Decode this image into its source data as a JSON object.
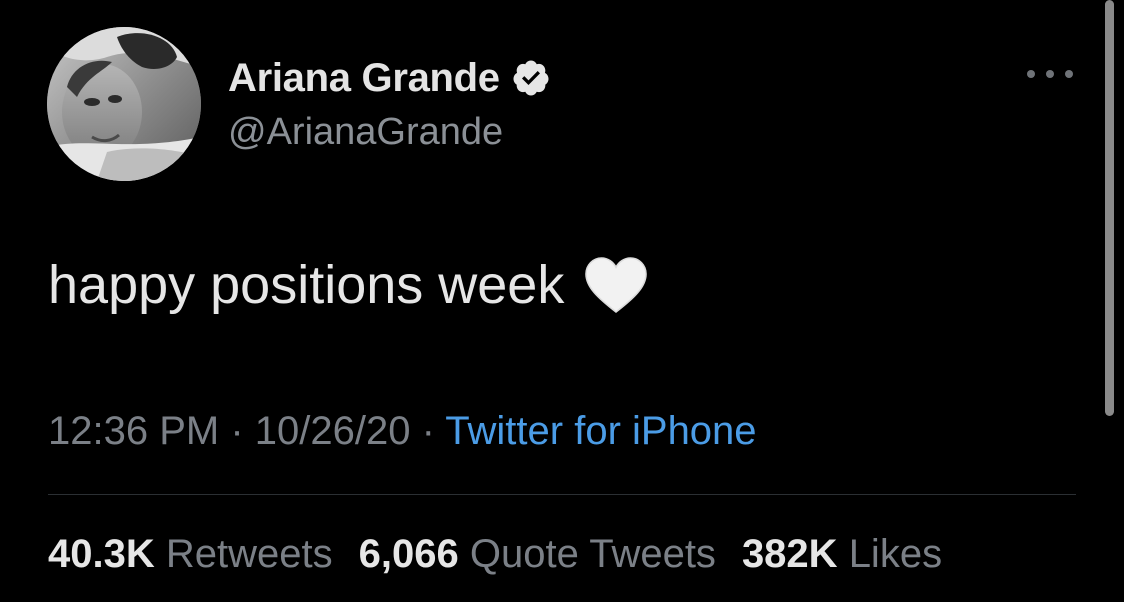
{
  "author": {
    "display_name": "Ariana Grande",
    "handle": "@ArianaGrande",
    "verified": true
  },
  "tweet": {
    "text": "happy positions week",
    "emoji": "white-heart",
    "time": "12:36 PM",
    "separator": " · ",
    "date": "10/26/20",
    "source": "Twitter for iPhone"
  },
  "stats": {
    "retweets_count": "40.3K",
    "retweets_label": "Retweets",
    "quotes_count": "6,066",
    "quotes_label": "Quote Tweets",
    "likes_count": "382K",
    "likes_label": "Likes"
  },
  "icons": {
    "verified": "verified-badge-icon",
    "more": "more-options-icon"
  },
  "colors": {
    "background": "#000000",
    "link": "#4b9ce6",
    "muted": "#7b8087",
    "text": "#e6e6e6"
  }
}
